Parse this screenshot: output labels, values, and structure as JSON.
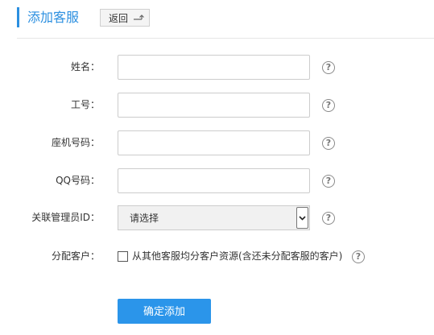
{
  "header": {
    "title": "添加客服",
    "back_label": "返回",
    "accent_color": "#2b8fe0"
  },
  "form": {
    "name_label": "姓名：",
    "employee_id_label": "工号：",
    "landline_label": "座机号码：",
    "qq_label": "QQ号码：",
    "manager_id_label": "关联管理员ID：",
    "manager_select_value": "请选择",
    "assign_customers_label": "分配客户：",
    "assign_customers_checkbox_label": "从其他客服均分客户资源(含还未分配客服的客户)",
    "help_symbol": "?",
    "submit_label": "确定添加",
    "submit_color": "#2b95ea"
  }
}
